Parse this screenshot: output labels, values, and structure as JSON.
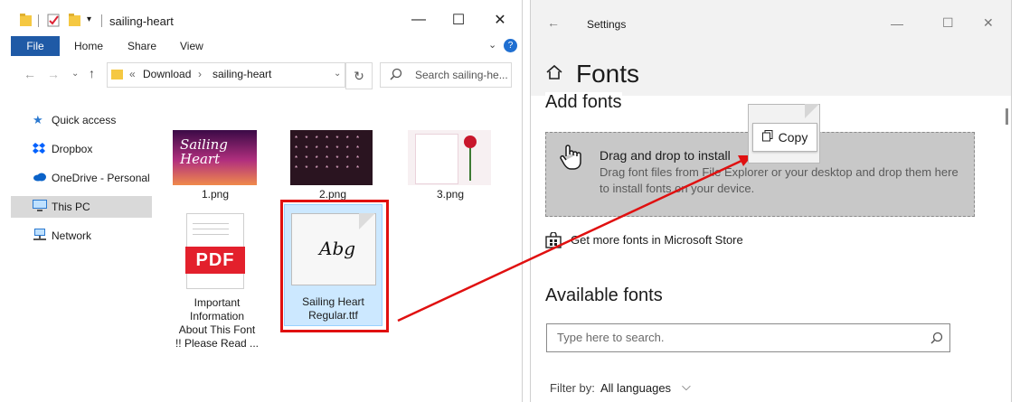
{
  "explorer": {
    "window_title": "sailing-heart",
    "ribbon_tabs": [
      "File",
      "Home",
      "Share",
      "View"
    ],
    "breadcrumb": {
      "overflow": "«",
      "parts": [
        "Download",
        "sailing-heart"
      ],
      "separator": "›"
    },
    "search_placeholder": "Search sailing-he...",
    "nav_items": [
      {
        "label": "Quick access",
        "icon": "star-icon"
      },
      {
        "label": "Dropbox",
        "icon": "dropbox-icon"
      },
      {
        "label": "OneDrive - Personal",
        "icon": "cloud-icon"
      },
      {
        "label": "This PC",
        "icon": "computer-icon",
        "selected": true
      },
      {
        "label": "Network",
        "icon": "network-icon"
      }
    ],
    "files": [
      {
        "name": "1.png",
        "thumb_text": "Sailing Heart"
      },
      {
        "name": "2.png"
      },
      {
        "name": "3.png"
      },
      {
        "name_lines": [
          "Important",
          "Information",
          "About This Font",
          "!! Please Read ..."
        ],
        "badge": "PDF"
      },
      {
        "name_lines": [
          "Sailing Heart",
          "Regular.ttf"
        ],
        "thumb_text": "Abg",
        "selected": true
      }
    ]
  },
  "settings": {
    "window_title": "Settings",
    "page_title": "Fonts",
    "add_fonts_heading": "Add fonts",
    "drop_title": "Drag and drop to install",
    "drop_desc_1": "Drag font files from File Explorer or your desktop and drop them here",
    "drop_desc_2": "to install fonts on your device.",
    "store_link": "Get more fonts in Microsoft Store",
    "available_heading": "Available fonts",
    "search_placeholder": "Type here to search.",
    "filter_label": "Filter by:",
    "filter_value": "All languages"
  },
  "drag_tooltip": "Copy",
  "colors": {
    "accent": "#1f5aa6",
    "annotation_red": "#e01010",
    "selection": "#cce8ff"
  }
}
